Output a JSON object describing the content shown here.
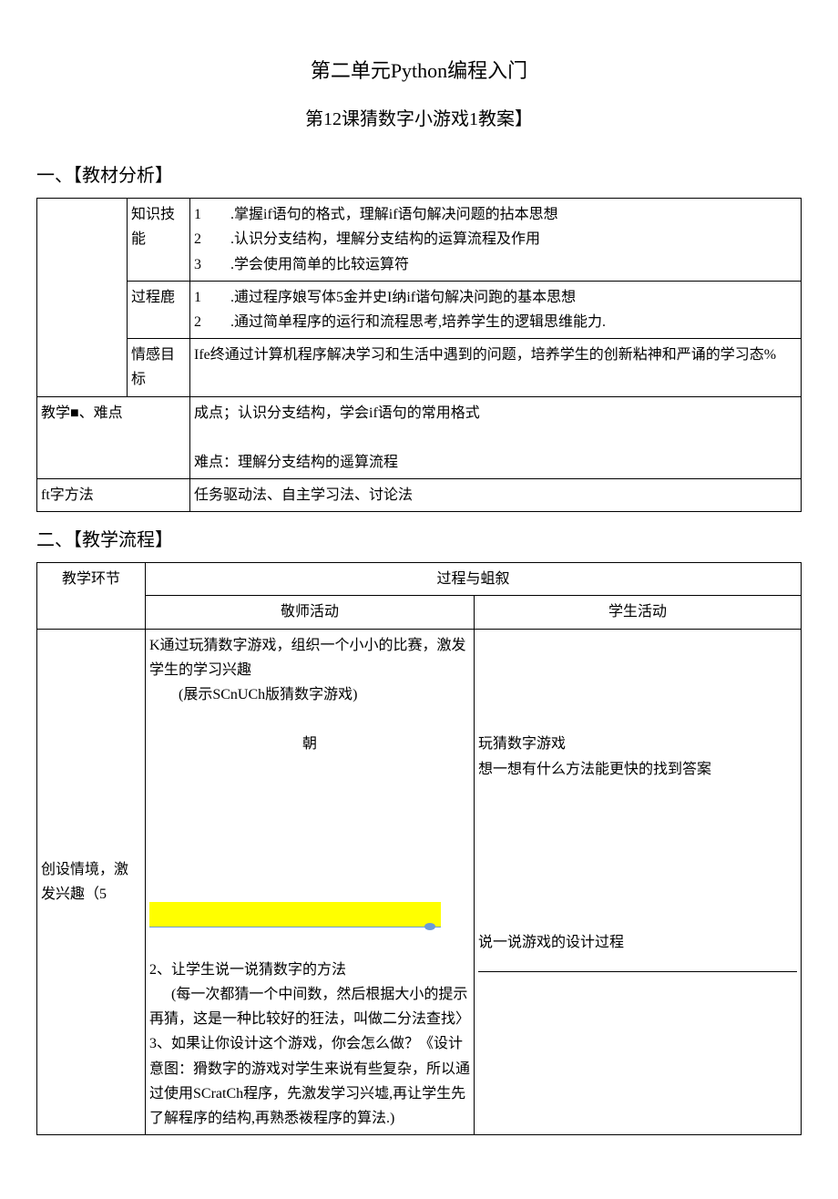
{
  "title": "第二单元Python编程入门",
  "subtitle": "第12课猜数字小游戏1教案】",
  "section1_heading": "一、【教材分析】",
  "table1": {
    "r1c2": "知识技能",
    "r1_n1": "1",
    "r1_t1": ".掌握if语句的格式，理解if语句解决问题的拈本思想",
    "r1_n2": "2",
    "r1_t2": ".认识分支结构，埋解分支结构的运算流程及作用",
    "r1_n3": "3",
    "r1_t3": ".学会使用简单的比较运算符",
    "r2c2": "过程鹿",
    "r2_n1": "1",
    "r2_t1": ".逋过程序娘写体5金并史I纳if谐句解决问跑的基本思想",
    "r2_n2": "2",
    "r2_t2": ".通过简单程序的运行和流程思考,培养学生的逻辑思维能力.",
    "r3c2": "情感目标",
    "r3_t": "Ife终通过计算机程序解决学习和生活中遇到的问题，培养学生的创新粘神和严诵的学习态%",
    "r4c1": "教学■、难点",
    "r4_t1": "成点；认识分支结构，学会if语句的常用格式",
    "r4_t2": "难点：理解分支结构的遥算流程",
    "r5c1": "ft字方法",
    "r5_t": "任务驱动法、自主学习法、讨论法"
  },
  "section2_heading": "二、【教学流程】",
  "table2": {
    "h1": "教学环节",
    "h2": "过程与蛆叙",
    "h2a": "敬师活动",
    "h2b": "学生活动",
    "stage1": "创设情境，激发兴趣（5",
    "teacher_block1": "K通过玩猜数字游戏，组织一个小小的比赛，激发学生的学习兴趣",
    "teacher_block1b": "(展示SCnUCh版猜数字游戏)",
    "teacher_center": "朝",
    "student_block1a": "玩猜数字游戏",
    "student_block1b": "想一想有什么方法能更快的找到答案",
    "teacher_block2": "2、让学生说一说猜数字的方法",
    "teacher_block2b": "(每一次都猜一个中间数，然后根据大小的提示再猜，这是一种比较好的狂法，叫做二分法查找〉",
    "teacher_block3": "3、如果让你设计这个游戏，你会怎么做？《设计意图：猾数字的游戏对学生来说有些复杂，所以通过使用SCratCh程序，先激发学习兴墟,再让学生先了解程序的结构,再熟悉袯程序的算法.)",
    "student_block2": "说一说游戏的设计过程"
  }
}
